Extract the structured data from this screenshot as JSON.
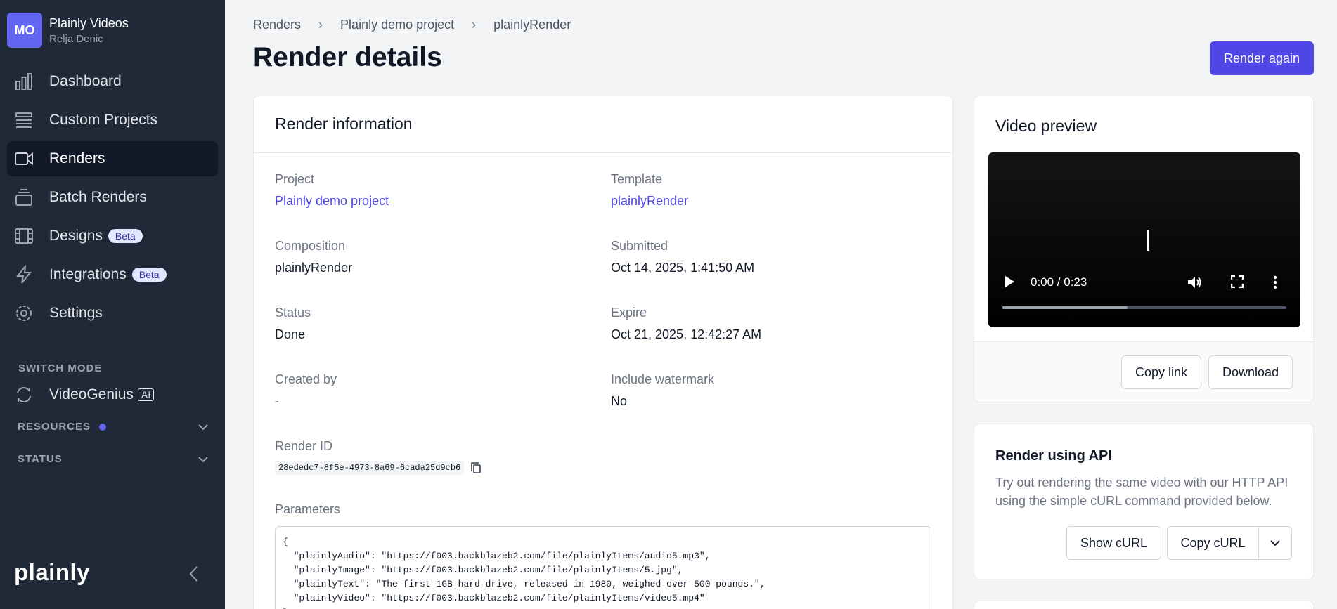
{
  "account": {
    "initials": "MO",
    "name": "Plainly Videos",
    "user": "Relja Denic"
  },
  "nav": {
    "dashboard": "Dashboard",
    "custom_projects": "Custom Projects",
    "renders": "Renders",
    "batch_renders": "Batch Renders",
    "designs": "Designs",
    "integrations": "Integrations",
    "settings": "Settings",
    "beta_badge": "Beta"
  },
  "switch_mode": {
    "label": "SWITCH MODE",
    "item": "VideoGenius",
    "badge": "AI"
  },
  "resources_label": "RESOURCES",
  "status_label": "STATUS",
  "logo": "plainly",
  "breadcrumb": [
    "Renders",
    "Plainly demo project",
    "plainlyRender"
  ],
  "page_title": "Render details",
  "render_again": "Render again",
  "info": {
    "header": "Render information",
    "project_label": "Project",
    "project_value": "Plainly demo project",
    "template_label": "Template",
    "template_value": "plainlyRender",
    "composition_label": "Composition",
    "composition_value": "plainlyRender",
    "submitted_label": "Submitted",
    "submitted_value": "Oct 14, 2025, 1:41:50 AM",
    "status_label": "Status",
    "status_value": "Done",
    "expire_label": "Expire",
    "expire_value": "Oct 21, 2025, 12:42:27 AM",
    "created_by_label": "Created by",
    "created_by_value": "-",
    "watermark_label": "Include watermark",
    "watermark_value": "No",
    "render_id_label": "Render ID",
    "render_id_value": "28ededc7-8f5e-4973-8a69-6cada25d9cb6",
    "parameters_label": "Parameters",
    "parameters_text": "{\n  \"plainlyAudio\": \"https://f003.backblazeb2.com/file/plainlyItems/audio5.mp3\",\n  \"plainlyImage\": \"https://f003.backblazeb2.com/file/plainlyItems/5.jpg\",\n  \"plainlyText\": \"The first 1GB hard drive, released in 1980, weighed over 500 pounds.\",\n  \"plainlyVideo\": \"https://f003.backblazeb2.com/file/plainlyItems/video5.mp4\"\n}"
  },
  "preview": {
    "title": "Video preview",
    "time": "0:00 / 0:23",
    "progress": 0.44,
    "copy_link": "Copy link",
    "download": "Download"
  },
  "api": {
    "title": "Render using API",
    "description": "Try out rendering the same video with our HTTP API using the simple cURL command provided below.",
    "show_curl": "Show cURL",
    "copy_curl": "Copy cURL"
  },
  "colors": {
    "sidebar": "#1f2937",
    "accent": "#4f46e5",
    "beta_bg": "#e0e7ff"
  }
}
